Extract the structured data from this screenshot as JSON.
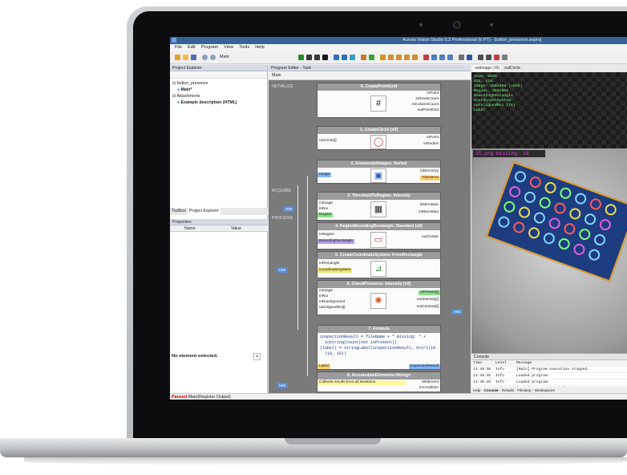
{
  "app": {
    "title": "Aurora Vision Studio 5.2 Professional (6 PT) - button_presence.avproj",
    "menu": [
      "File",
      "Edit",
      "Program",
      "View",
      "Tools",
      "Help"
    ],
    "toolbar_label": "Main"
  },
  "project_explorer": {
    "title": "Project Explorer",
    "items": [
      "button_presence",
      "Main*",
      "Attachments",
      "Example description (HTML)"
    ],
    "tabs": [
      "Toolbox",
      "Project Explorer"
    ]
  },
  "properties": {
    "title": "Properties",
    "columns": [
      "Name",
      "Value"
    ],
    "empty_text": "No element selected."
  },
  "status": {
    "state": "Paused",
    "text": "Main(Register Output)"
  },
  "editor": {
    "title": "Program Editor - Task",
    "worker": "Main",
    "sections": [
      "INITIALIZE",
      "ACQUIRE",
      "PROCESS"
    ],
    "hmi_label": "HMI",
    "nodes": [
      {
        "title": "0. CreatePointGrid",
        "inputs": [],
        "outputs": [
          "inPoint",
          "inRowsCount",
          "inColumnCount",
          "outPointGrid"
        ]
      },
      {
        "title": "1. CreateCircle [x0]",
        "inputs": [
          "outCircle[]"
        ],
        "outputs": [
          "inPoint",
          "inRadius"
        ]
      },
      {
        "title": "2. EnumerateImages: Sorted",
        "inputs": [
          "Image"
        ],
        "outputs": [
          "inDirectory",
          "FileName"
        ]
      },
      {
        "title": "3. ThresholdToRegion: Intensity",
        "inputs": [
          "inImage",
          "inRoi",
          "Region"
        ],
        "outputs": [
          "inMinValue",
          "inMaxValue"
        ]
      },
      {
        "title": "4. RegionBoundingRectangle: Standard (x0)",
        "inputs": [
          "inRegion",
          "BoundingRectangle"
        ],
        "outputs": [
          "outCenter"
        ]
      },
      {
        "title": "5. CreateCoordinateSystem: FromRectangle",
        "inputs": [
          "inRectangle",
          "CoordinateSystem"
        ],
        "outputs": []
      },
      {
        "title": "6. CheckPresence: Intensity [x0]",
        "inputs": [
          "inImage",
          "inRoi",
          "inRoiAlignment",
          "outAlignedRoi[]"
        ],
        "outputs": [
          "isPresent[]",
          "outIntensity[]",
          "outContrast[]"
        ]
      },
      {
        "title": "7. Formula",
        "inputs": [
          "Label"
        ],
        "outputs": [
          "InspectionResult"
        ]
      },
      {
        "title": "8. AccumulateElements<String>",
        "inputs": [
          "Collects results from all iterations"
        ],
        "outputs": [
          "inElement",
          "inCondition",
          "outArray"
        ]
      }
    ],
    "formula_lines": [
      "inspectionResult = fileName + \" missing: \" +",
      "  toString(count(not isPresent))",
      "(label) = stringLabel(inspectionResult, #ctrl(10",
      "  (10, 10))"
    ]
  },
  "viewer": {
    "tabs": [
      "outImage (16)",
      "outCircle"
    ],
    "info_lines": [
      "Zoom: 258%",
      "225, 218",
      "Image: 368x308 (x8x8)",
      "Region: 368x308",
      "BoundingRectangle",
      "CoordinateSystem",
      "outAlignedRoi (16)",
      "Label"
    ],
    "missing_text": "15.png missing: 16"
  },
  "console": {
    "title": "Console",
    "columns": [
      "Time",
      "Level",
      "Message"
    ],
    "rows": [
      {
        "time": "13:40:36",
        "level": "Info",
        "message": "[Main] Program execution stopped."
      },
      {
        "time": "13:40:45",
        "level": "Info",
        "message": "Loaded program."
      },
      {
        "time": "13:40:45",
        "level": "Info",
        "message": "Loaded program."
      },
      {
        "time": "13:40:46",
        "level": "Info",
        "message": "[Main] Program initialized."
      }
    ],
    "bottom_tabs": [
      "Help",
      "Console",
      "Results",
      "Filmstrip",
      "Workspaces"
    ]
  },
  "colors": {
    "titlebar": "#3a5f9a",
    "editor_bg": "#7a7a7a",
    "hmi": "#5a8fd0",
    "missing_text": "#e040e0",
    "board": "#1e3c80"
  }
}
